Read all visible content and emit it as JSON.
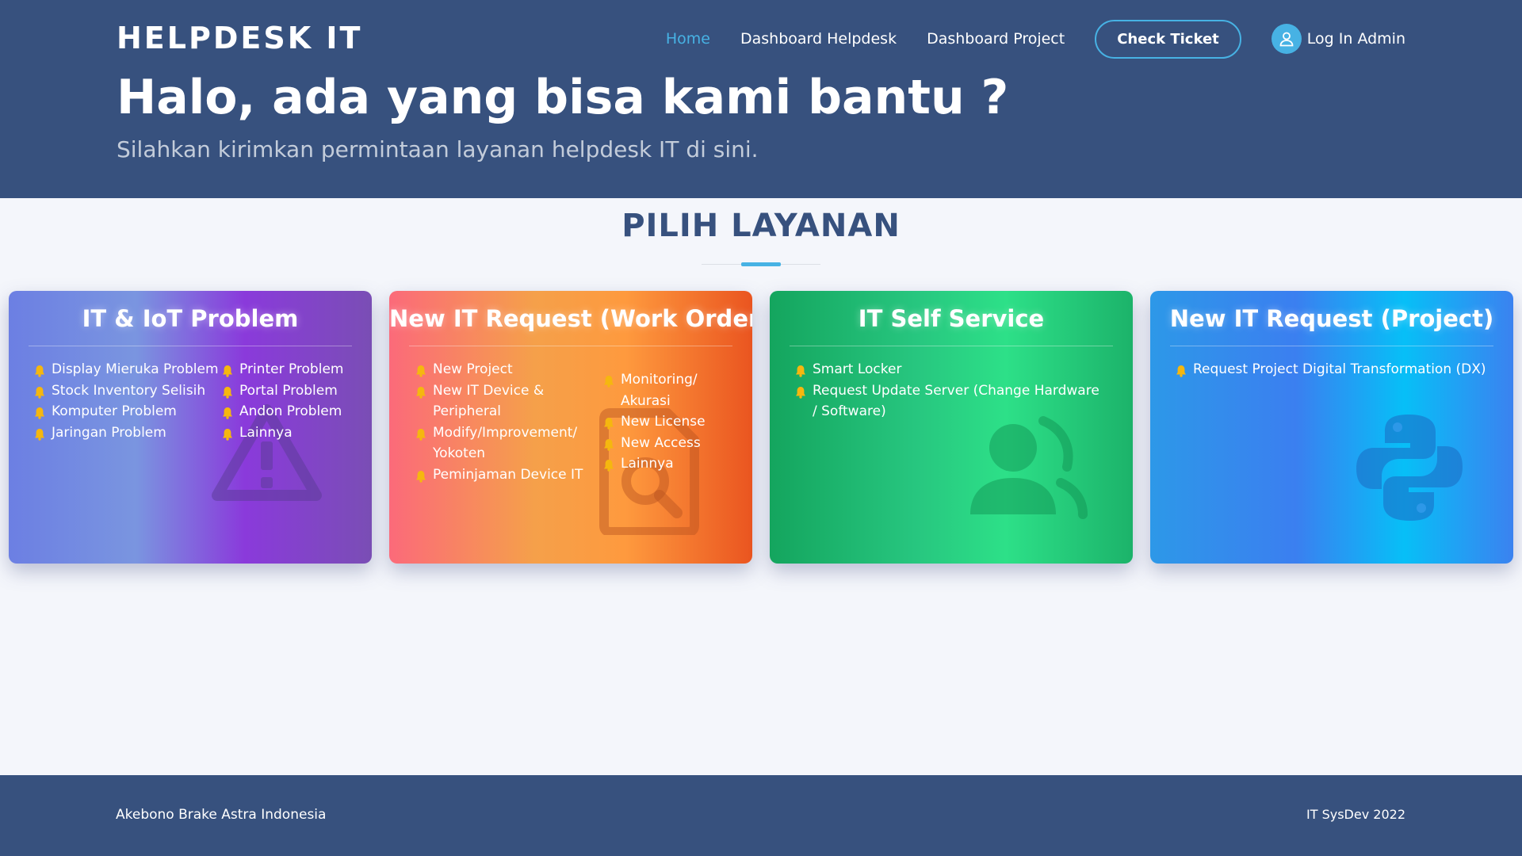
{
  "header": {
    "brand": "HELPDESK IT",
    "nav": {
      "home": "Home",
      "dashboard_helpdesk": "Dashboard Helpdesk",
      "dashboard_project": "Dashboard Project",
      "check_ticket": "Check Ticket",
      "login": "Log In Admin"
    },
    "title": "Halo, ada yang bisa kami bantu ?",
    "subtitle": "Silahkan kirimkan permintaan layanan helpdesk IT di sini."
  },
  "section": {
    "title": "PILIH LAYANAN"
  },
  "cards": [
    {
      "title": "IT & IoT Problem",
      "col1": [
        "Display Mieruka Problem",
        "Stock Inventory Selisih",
        "Komputer Problem",
        "Jaringan Problem"
      ],
      "col2": [
        "Printer Problem",
        "Portal Problem",
        "Andon Problem",
        "Lainnya"
      ],
      "icon": "warning-icon"
    },
    {
      "title": "New IT Request (Work Order)",
      "col1": [
        "New Project",
        "New IT Device & Peripheral",
        "Modify/Improvement/ Yokoten",
        "Peminjaman Device IT"
      ],
      "col2": [
        "Monitoring/ Akurasi",
        "New License",
        "New Access",
        "Lainnya"
      ],
      "icon": "file-search-icon"
    },
    {
      "title": "IT Self Service",
      "col1": [
        "Smart Locker",
        "Request Update Server (Change Hardware / Software)"
      ],
      "icon": "user-support-icon"
    },
    {
      "title": "New IT Request (Project)",
      "col1": [
        "Request Project Digital Transformation (DX)"
      ],
      "icon": "python-icon"
    }
  ],
  "footer": {
    "company": "Akebono Brake Astra Indonesia",
    "credit": "IT SysDev 2022"
  },
  "colors": {
    "primary": "#37517e",
    "accent": "#47b2e4",
    "background": "#f4f6fb",
    "bell": "#f5b70f"
  }
}
